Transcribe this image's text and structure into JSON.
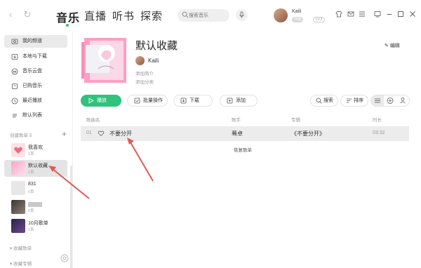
{
  "topbar": {
    "tabs": [
      {
        "label": "音乐",
        "active": true
      },
      {
        "label": "直播",
        "active": false
      },
      {
        "label": "听书",
        "active": false
      },
      {
        "label": "探索",
        "active": false
      }
    ],
    "search_placeholder": "搜索音乐",
    "user_name": "Kaili",
    "vip_label": "开通",
    "level_label": "LV.3"
  },
  "sidebar": {
    "items": [
      {
        "label": "我的频道",
        "icon": "channel-icon",
        "active": true
      },
      {
        "label": "本地与下载",
        "icon": "download-icon",
        "active": false
      },
      {
        "label": "音乐云盘",
        "icon": "cloud-icon",
        "active": false
      },
      {
        "label": "已购音乐",
        "icon": "purchased-icon",
        "active": false
      },
      {
        "label": "最近播放",
        "icon": "clock-icon",
        "active": false
      },
      {
        "label": "默认列表",
        "icon": "list-icon",
        "active": false
      }
    ],
    "created_section": "创建歌单 5",
    "playlists": [
      {
        "title": "我喜欢",
        "count": "1首",
        "active": false
      },
      {
        "title": "默认收藏",
        "count": "1首",
        "active": true
      },
      {
        "title": "831",
        "count": "0首",
        "active": false
      },
      {
        "title": "",
        "count": "0首",
        "active": false
      },
      {
        "title": "10月歌单",
        "count": "1首",
        "active": false
      }
    ],
    "collected_section": "收藏歌单",
    "collected_albums": "收藏专辑"
  },
  "playlist": {
    "title": "默认收藏",
    "edit_label": "编辑",
    "owner": "Kaili",
    "add_intro": "添加简介",
    "add_category": "添加分类"
  },
  "toolbar": {
    "play": "播放",
    "batch": "批量操作",
    "download": "下载",
    "add": "添加",
    "search": "搜索",
    "sort": "排序"
  },
  "table": {
    "headers": {
      "title": "歌曲名",
      "artist": "歌手",
      "album": "专辑",
      "duration": "时长"
    },
    "rows": [
      {
        "num": "01",
        "title": "不要分开",
        "artist": "蓦卓",
        "album": "《不要分开》",
        "duration": "03:32"
      }
    ],
    "restore_label": "恢复歌单"
  },
  "colors": {
    "accent": "#31c27c",
    "arrow": "#e05a55"
  }
}
